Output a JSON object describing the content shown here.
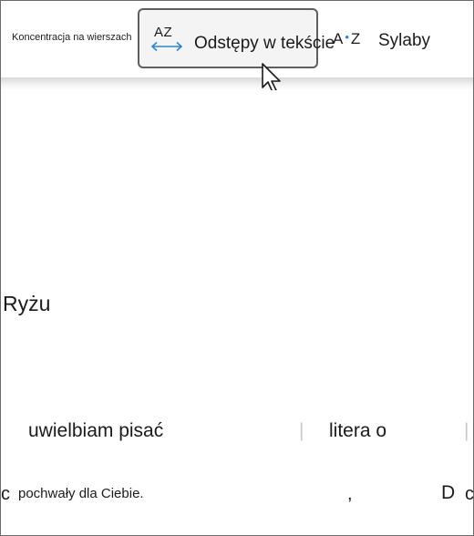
{
  "toolbar": {
    "line_focus_label": "Koncentracja na wierszach",
    "text_spacing": {
      "icon_text": "AZ",
      "label": "Odstępy w tekście"
    },
    "syllables": {
      "icon_text_a": "A",
      "icon_text_dot": "•",
      "icon_text_z": "Z",
      "label": "Sylaby"
    }
  },
  "document": {
    "word_1": "Ryżu",
    "word_2": "uwielbiam pisać",
    "word_3": "litera o",
    "fragment_c": "c",
    "phrase": "pochwały dla Ciebie.",
    "comma": ",",
    "fragment_d": "D",
    "fragment_c2": "c"
  },
  "colors": {
    "accent": "#2d86c9",
    "text": "#1b1b1b",
    "selected_button_bg": "#f4f4f4",
    "selected_button_border": "#5f5f5f"
  },
  "icons": [
    "text-spacing-icon",
    "syllables-icon",
    "mouse-pointer-icon"
  ]
}
